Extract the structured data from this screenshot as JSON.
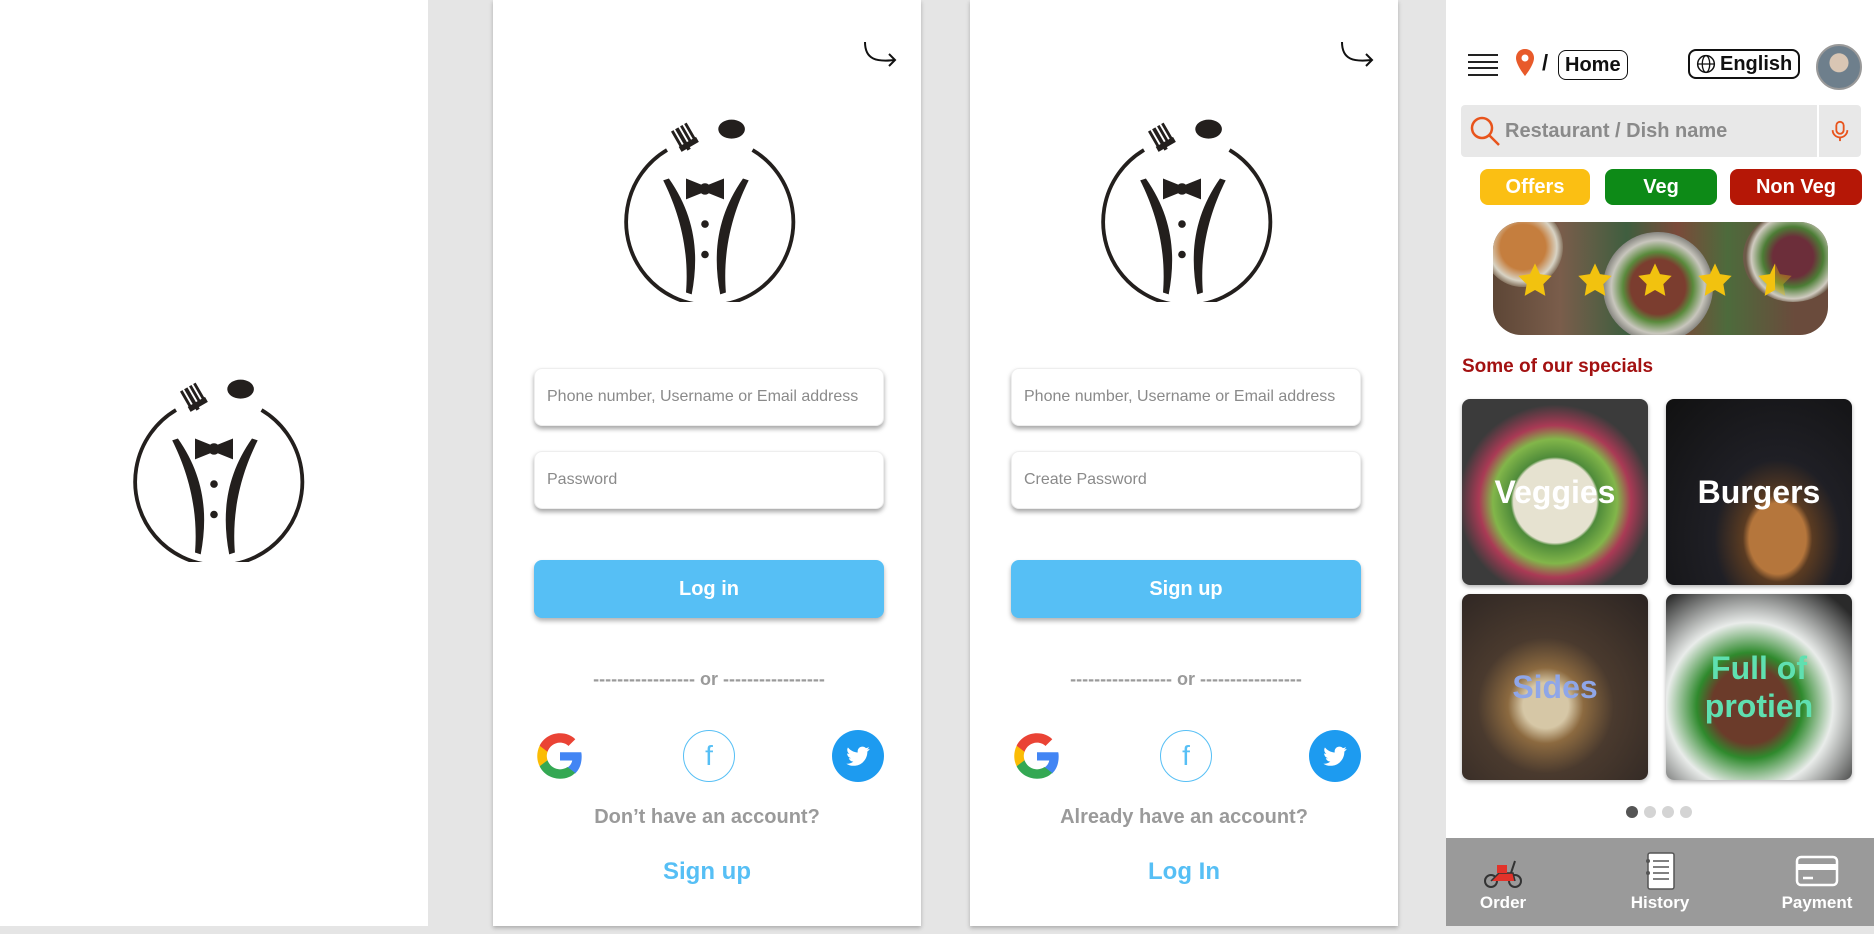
{
  "login": {
    "username_placeholder": "Phone number, Username or Email address",
    "password_placeholder": "Password",
    "login_label": "Log in",
    "divider": "----------------- or -----------------",
    "prompt": "Don’t have an account?",
    "link": "Sign up"
  },
  "signup": {
    "username_placeholder": "Phone number, Username or Email address",
    "password_placeholder": "Create Password",
    "signup_label": "Sign up",
    "divider": "----------------- or -----------------",
    "prompt": "Already have an account?",
    "link": "Log In"
  },
  "home": {
    "location_separator": "/",
    "location": "Home",
    "language": "English",
    "search_placeholder": "Restaurant / Dish name",
    "filters": [
      "Offers",
      "Veg",
      "Non Veg"
    ],
    "section_title": "Some of our specials",
    "specials": [
      "Veggies",
      "Burgers",
      "Sides",
      "Full of protien"
    ],
    "rating_stars": 4.5,
    "carousel": {
      "pages": 4,
      "active": 1
    },
    "nav": [
      "Order",
      "History",
      "Payment"
    ]
  },
  "colors": {
    "brand_blue": "#56bff5",
    "offers": "#fbbf13",
    "veg": "#0d8a17",
    "nonveg": "#b51706",
    "section_title": "#a31111",
    "nav_bg": "#9a9a9a"
  },
  "icons": [
    "logo-icon",
    "redo-arrow-icon",
    "google-icon",
    "facebook-icon",
    "twitter-icon",
    "hamburger-icon",
    "location-pin-icon",
    "globe-icon",
    "search-icon",
    "microphone-icon",
    "star-icon",
    "scooter-icon",
    "history-icon",
    "payment-card-icon"
  ]
}
